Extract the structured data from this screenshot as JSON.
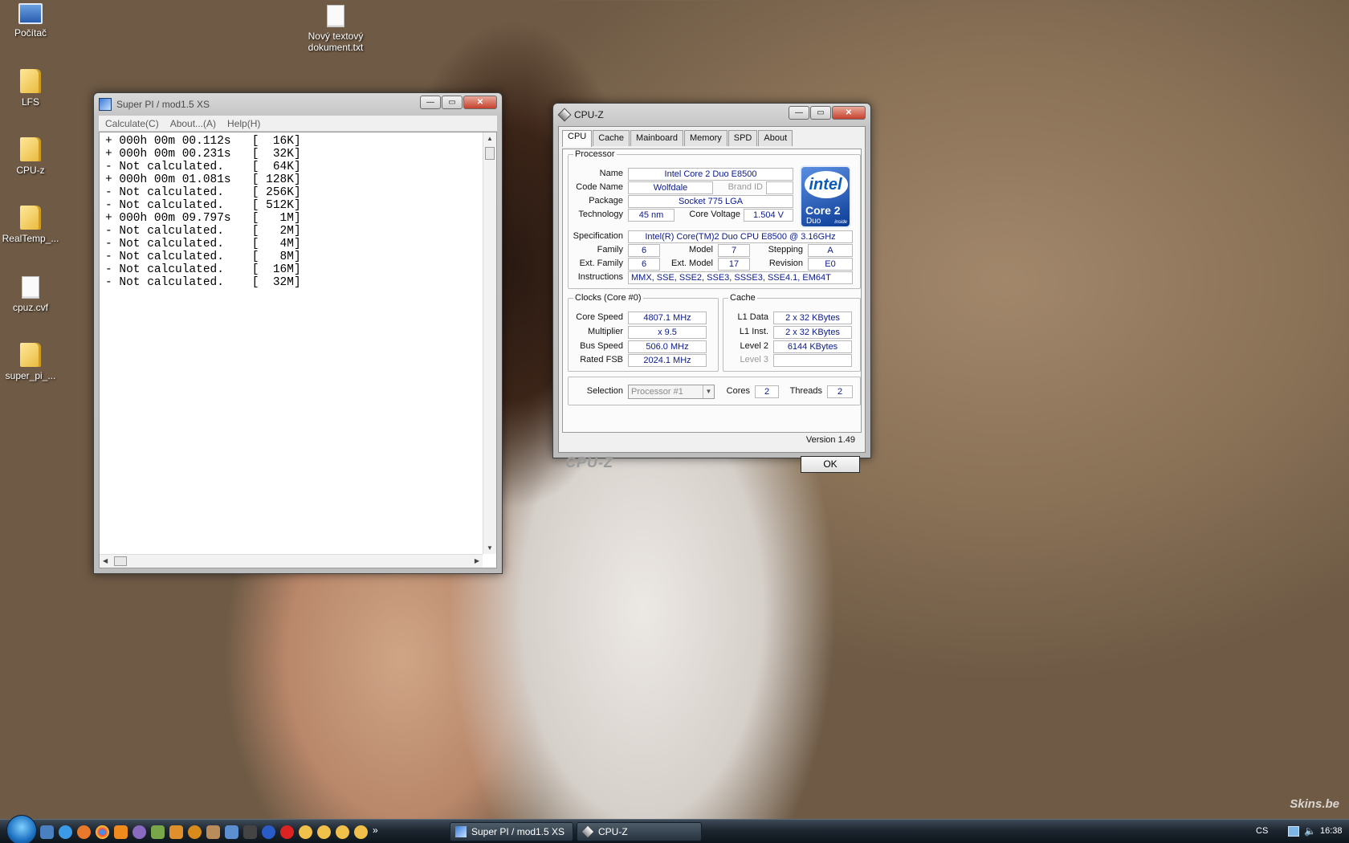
{
  "desktop": {
    "icons": [
      {
        "label": "Počítač",
        "kind": "computer"
      },
      {
        "label": "LFS",
        "kind": "folder"
      },
      {
        "label": "CPU-z",
        "kind": "folder"
      },
      {
        "label": "RealTemp_...",
        "kind": "folder"
      },
      {
        "label": "cpuz.cvf",
        "kind": "file"
      },
      {
        "label": "super_pi_...",
        "kind": "folder"
      },
      {
        "label": "Nový textový dokument.txt",
        "kind": "file"
      }
    ],
    "watermark": "Skins.be"
  },
  "superpi": {
    "title": "Super PI / mod1.5 XS",
    "menu": {
      "calculate": "Calculate(C)",
      "about": "About...(A)",
      "help": "Help(H)"
    },
    "results": [
      "+ 000h 00m 00.112s   [  16K]",
      "+ 000h 00m 00.231s   [  32K]",
      "- Not calculated.    [  64K]",
      "+ 000h 00m 01.081s   [ 128K]",
      "- Not calculated.    [ 256K]",
      "- Not calculated.    [ 512K]",
      "+ 000h 00m 09.797s   [   1M]",
      "- Not calculated.    [   2M]",
      "- Not calculated.    [   4M]",
      "- Not calculated.    [   8M]",
      "- Not calculated.    [  16M]",
      "- Not calculated.    [  32M]"
    ]
  },
  "cpuz": {
    "title": "CPU-Z",
    "tabs": [
      "CPU",
      "Cache",
      "Mainboard",
      "Memory",
      "SPD",
      "About"
    ],
    "processor": {
      "legend": "Processor",
      "name_label": "Name",
      "name": "Intel Core 2 Duo E8500",
      "codename_label": "Code Name",
      "codename": "Wolfdale",
      "brandid_label": "Brand ID",
      "brandid": "",
      "package_label": "Package",
      "package": "Socket 775 LGA",
      "technology_label": "Technology",
      "technology": "45 nm",
      "voltage_label": "Core Voltage",
      "voltage": "1.504 V",
      "spec_label": "Specification",
      "spec": "Intel(R) Core(TM)2 Duo CPU     E8500  @ 3.16GHz",
      "family_label": "Family",
      "family": "6",
      "model_label": "Model",
      "model": "7",
      "stepping_label": "Stepping",
      "stepping": "A",
      "extfamily_label": "Ext. Family",
      "extfamily": "6",
      "extmodel_label": "Ext. Model",
      "extmodel": "17",
      "revision_label": "Revision",
      "revision": "E0",
      "instructions_label": "Instructions",
      "instructions": "MMX, SSE, SSE2, SSE3, SSSE3, SSE4.1, EM64T"
    },
    "logo": {
      "word": "intel",
      "line1": "Core 2",
      "line2": "Duo",
      "line3": "inside"
    },
    "clocks": {
      "legend": "Clocks (Core #0)",
      "corespeed_label": "Core Speed",
      "corespeed": "4807.1 MHz",
      "multiplier_label": "Multiplier",
      "multiplier": "x 9.5",
      "busspeed_label": "Bus Speed",
      "busspeed": "506.0 MHz",
      "ratedfsb_label": "Rated FSB",
      "ratedfsb": "2024.1 MHz"
    },
    "cache": {
      "legend": "Cache",
      "l1data_label": "L1 Data",
      "l1data": "2 x 32 KBytes",
      "l1inst_label": "L1 Inst.",
      "l1inst": "2 x 32 KBytes",
      "level2_label": "Level 2",
      "level2": "6144 KBytes",
      "level3_label": "Level 3",
      "level3": ""
    },
    "selection_label": "Selection",
    "selection": "Processor #1",
    "cores_label": "Cores",
    "cores": "2",
    "threads_label": "Threads",
    "threads": "2",
    "version": "Version 1.49",
    "brand": "CPU-Z",
    "ok": "OK"
  },
  "taskbar": {
    "tasks": [
      "Super PI / mod1.5 XS",
      "CPU-Z"
    ],
    "more": "»",
    "language": "CS",
    "clock": "16:38"
  }
}
